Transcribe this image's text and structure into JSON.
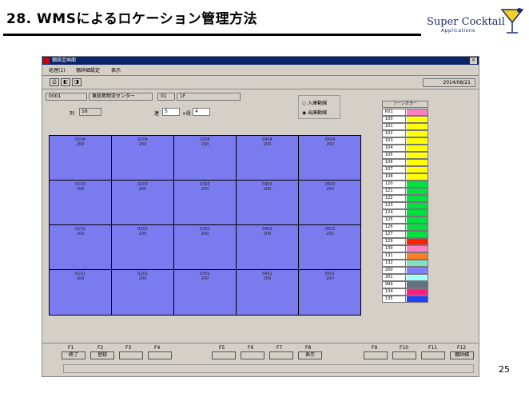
{
  "slide": {
    "title": "28. WMSによるロケーション管理方法",
    "brand_name": "Super Cocktail",
    "brand_sub": "Applications",
    "page_number": "25"
  },
  "window": {
    "title": "棚設定画面",
    "close_glyph": "×",
    "menu": [
      "処理(1)",
      "棚詳細設定",
      "表示"
    ],
    "toolbar": [
      "⎙",
      "◧",
      "◨"
    ],
    "date": "2014/08/21"
  },
  "info": {
    "code": "0001",
    "warehouse": "東扇島物流センター",
    "area": "01",
    "floor": "1F",
    "row_label": "列",
    "row_value": "16",
    "ren_label": "連",
    "ren_value": "5",
    "dan_label": "×段",
    "dan_value": "4"
  },
  "radio": {
    "options": [
      {
        "label": "入庫動線",
        "selected": false
      },
      {
        "label": "出庫動線",
        "selected": true
      }
    ]
  },
  "grid": {
    "color": "#7b7bf0",
    "rows": [
      [
        {
          "code": "0104",
          "qty": "200"
        },
        {
          "code": "0204",
          "qty": "200"
        },
        {
          "code": "0304",
          "qty": "200"
        },
        {
          "code": "0404",
          "qty": "200"
        },
        {
          "code": "0504",
          "qty": "200"
        }
      ],
      [
        {
          "code": "0103",
          "qty": "200"
        },
        {
          "code": "0203",
          "qty": "200"
        },
        {
          "code": "0303",
          "qty": "200"
        },
        {
          "code": "0403",
          "qty": "200"
        },
        {
          "code": "0503",
          "qty": "200"
        }
      ],
      [
        {
          "code": "0102",
          "qty": "200"
        },
        {
          "code": "0202",
          "qty": "200"
        },
        {
          "code": "0302",
          "qty": "200"
        },
        {
          "code": "0402",
          "qty": "200"
        },
        {
          "code": "0502",
          "qty": "200"
        }
      ],
      [
        {
          "code": "0101",
          "qty": "200"
        },
        {
          "code": "0201",
          "qty": "200"
        },
        {
          "code": "0301",
          "qty": "200"
        },
        {
          "code": "0401",
          "qty": "200"
        },
        {
          "code": "0501",
          "qty": "200"
        }
      ]
    ]
  },
  "zones": {
    "header": "ゾーンカラー",
    "items": [
      {
        "code": "K01",
        "color": "#ff80c0"
      },
      {
        "code": "100",
        "color": "#ffff00"
      },
      {
        "code": "101",
        "color": "#ffff00"
      },
      {
        "code": "102",
        "color": "#ffff00"
      },
      {
        "code": "103",
        "color": "#ffff00"
      },
      {
        "code": "104",
        "color": "#ffff00"
      },
      {
        "code": "105",
        "color": "#ffff00"
      },
      {
        "code": "106",
        "color": "#ffff00"
      },
      {
        "code": "107",
        "color": "#ffff00"
      },
      {
        "code": "108",
        "color": "#ffff00"
      },
      {
        "code": "120",
        "color": "#00e040"
      },
      {
        "code": "121",
        "color": "#00e040"
      },
      {
        "code": "122",
        "color": "#00e040"
      },
      {
        "code": "123",
        "color": "#00e040"
      },
      {
        "code": "124",
        "color": "#00e040"
      },
      {
        "code": "125",
        "color": "#00e040"
      },
      {
        "code": "126",
        "color": "#00e040"
      },
      {
        "code": "127",
        "color": "#00e040"
      },
      {
        "code": "129",
        "color": "#ff2000"
      },
      {
        "code": "130",
        "color": "#ff80c0"
      },
      {
        "code": "131",
        "color": "#ff8020"
      },
      {
        "code": "132",
        "color": "#80e0c0"
      },
      {
        "code": "200",
        "color": "#8080ff"
      },
      {
        "code": "201",
        "color": "#a0ffff"
      },
      {
        "code": "999",
        "color": "#607080"
      },
      {
        "code": "134",
        "color": "#ff2080"
      },
      {
        "code": "135",
        "color": "#2040ff"
      }
    ]
  },
  "fkeys": [
    {
      "key": "F1",
      "label": "終了"
    },
    {
      "key": "F2",
      "label": "登録"
    },
    {
      "key": "F3",
      "label": ""
    },
    {
      "key": "F4",
      "label": ""
    },
    {
      "key": "F5",
      "label": ""
    },
    {
      "key": "F6",
      "label": ""
    },
    {
      "key": "F7",
      "label": ""
    },
    {
      "key": "F8",
      "label": "表示"
    },
    {
      "key": "F9",
      "label": ""
    },
    {
      "key": "F10",
      "label": ""
    },
    {
      "key": "F11",
      "label": ""
    },
    {
      "key": "F12",
      "label": "棚詳細"
    }
  ]
}
